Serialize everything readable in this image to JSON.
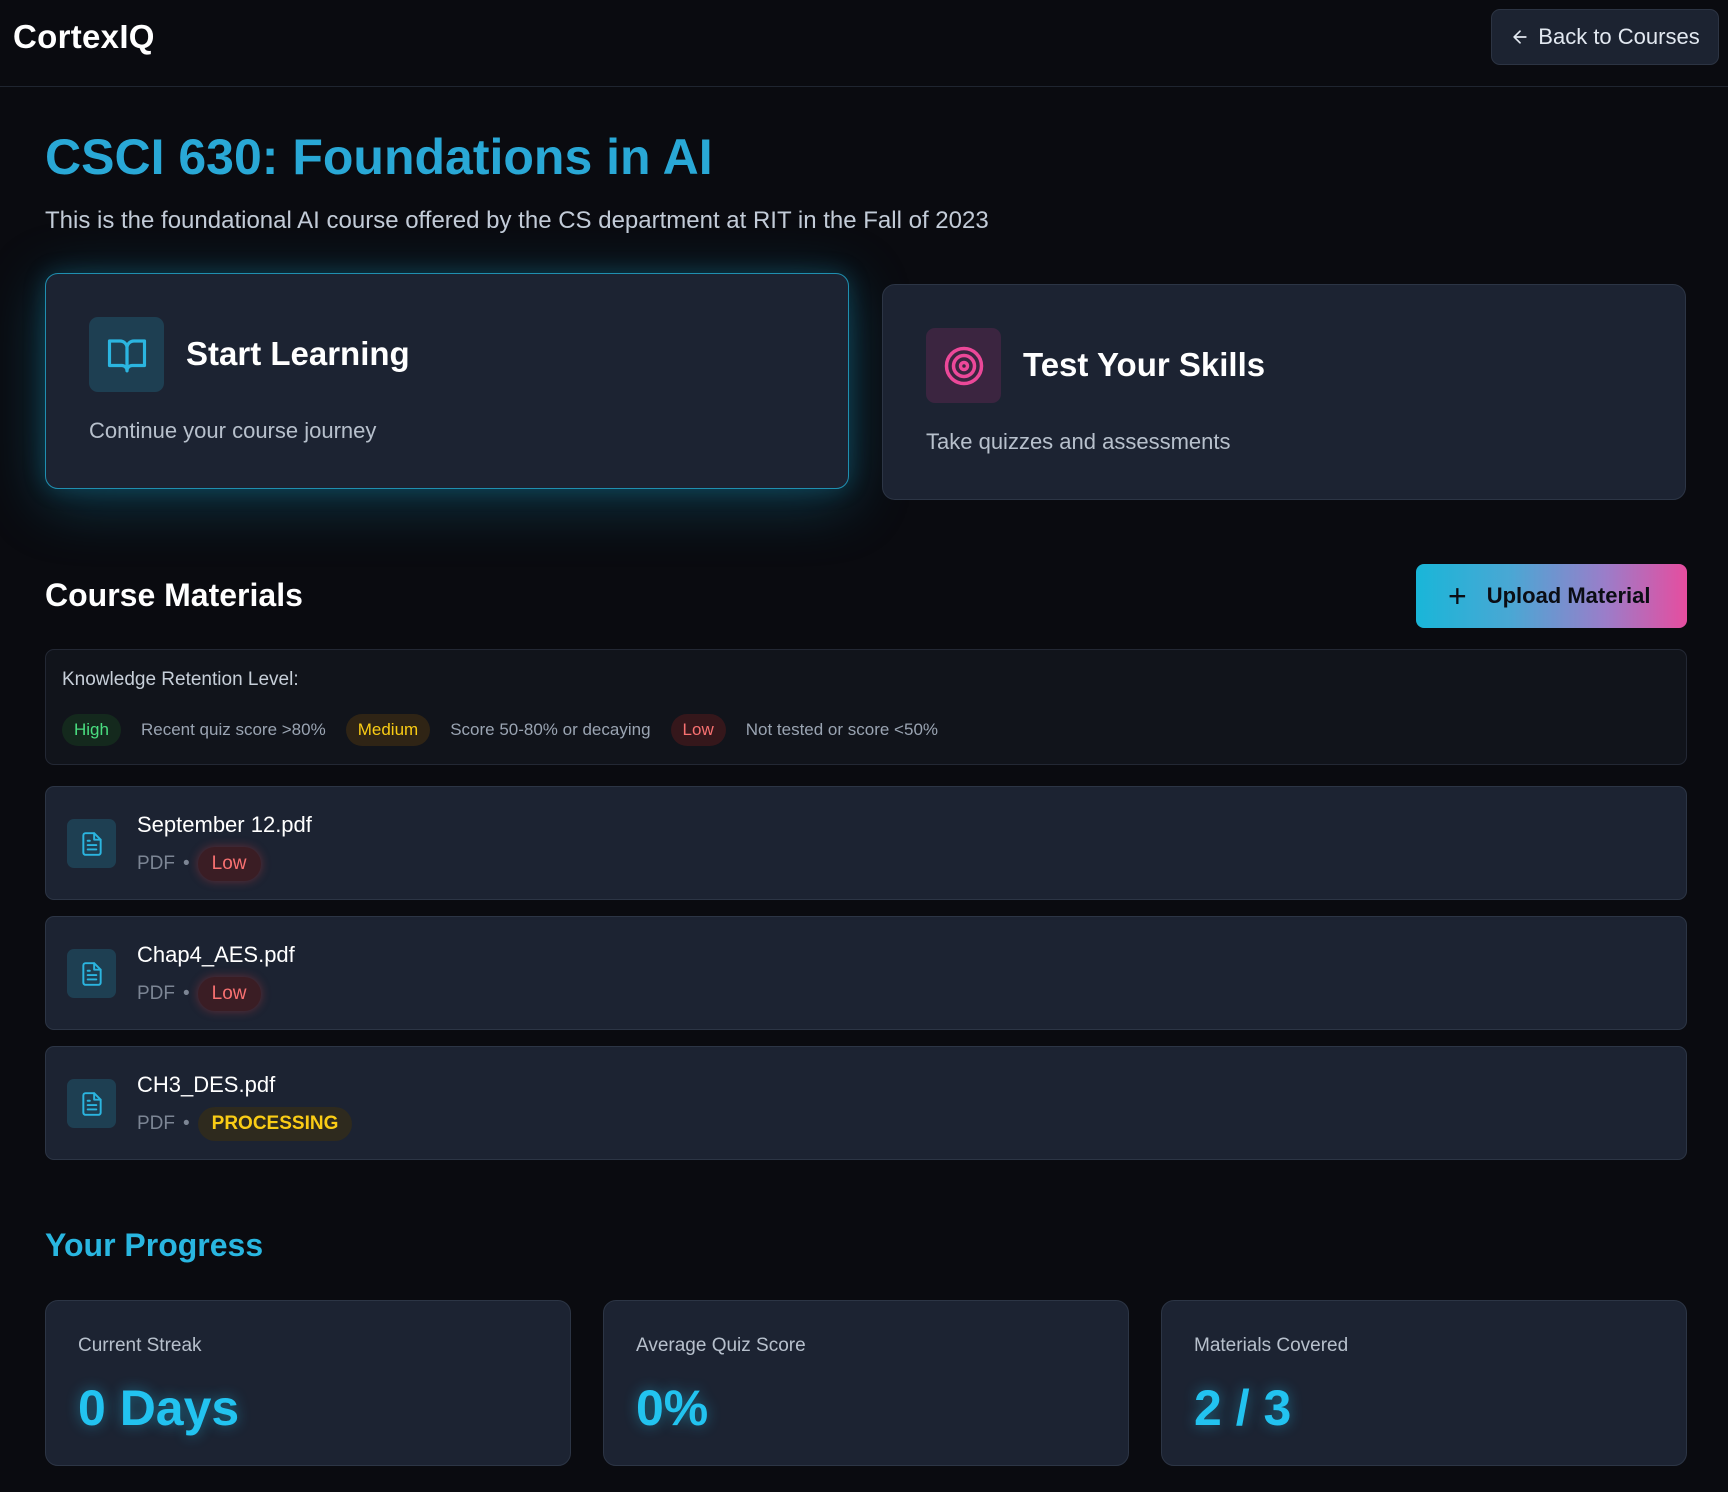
{
  "app": {
    "name": "CortexIQ"
  },
  "header": {
    "back_label": "Back to Courses"
  },
  "course": {
    "title": "CSCI 630: Foundations in AI",
    "description": "This is the foundational AI course offered by the CS department at RIT in the Fall of 2023"
  },
  "cards": {
    "learn": {
      "title": "Start Learning",
      "subtitle": "Continue your course journey",
      "icon": "book-open-icon"
    },
    "skills": {
      "title": "Test Your Skills",
      "subtitle": "Take quizzes and assessments",
      "icon": "target-icon"
    }
  },
  "materials_section": {
    "title": "Course Materials",
    "upload_label": "Upload Material"
  },
  "legend": {
    "title": "Knowledge Retention Level:",
    "levels": [
      {
        "badge": "High",
        "description": "Recent quiz score >80%",
        "color": "#4ade80"
      },
      {
        "badge": "Medium",
        "description": "Score 50-80% or decaying",
        "color": "#facc15"
      },
      {
        "badge": "Low",
        "description": "Not tested or score <50%",
        "color": "#f87171"
      }
    ]
  },
  "materials": [
    {
      "name": "September 12.pdf",
      "type": "PDF",
      "separator": "•",
      "status": "Low",
      "icon": "file-text-icon"
    },
    {
      "name": "Chap4_AES.pdf",
      "type": "PDF",
      "separator": "•",
      "status": "Low",
      "icon": "file-text-icon"
    },
    {
      "name": "CH3_DES.pdf",
      "type": "PDF",
      "separator": "•",
      "status": "PROCESSING",
      "icon": "file-text-icon"
    }
  ],
  "progress": {
    "title": "Your Progress",
    "stats": [
      {
        "label": "Current Streak",
        "value": "0 Days"
      },
      {
        "label": "Average Quiz Score",
        "value": "0%"
      },
      {
        "label": "Materials Covered",
        "value": "2 / 3"
      }
    ]
  },
  "colors": {
    "accent": "#29a8d6",
    "background": "#0a0b10",
    "card": "#1c2332"
  }
}
